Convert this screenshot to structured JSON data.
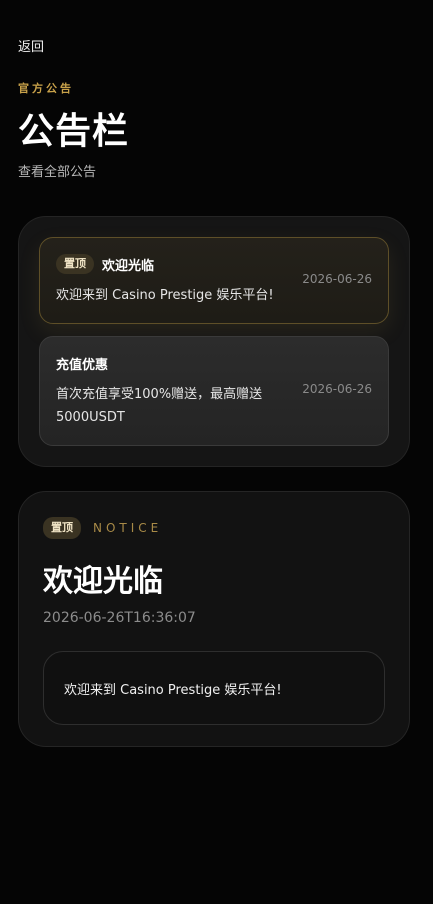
{
  "nav": {
    "back_label": "返回"
  },
  "header": {
    "eyebrow": "官方公告",
    "title": "公告栏",
    "subtitle": "查看全部公告"
  },
  "notices": [
    {
      "pinned": true,
      "pin_label": "置顶",
      "title": "欢迎光临",
      "body": "欢迎来到 Casino Prestige 娱乐平台!",
      "date": "2026-06-26"
    },
    {
      "pinned": false,
      "title": "充值优惠",
      "body": "首次充值享受100%赠送，最高赠送5000USDT",
      "date": "2026-06-26"
    }
  ],
  "detail": {
    "pin_label": "置顶",
    "eyebrow": "NOTICE",
    "title": "欢迎光临",
    "timestamp": "2026-06-26T16:36:07",
    "content": "欢迎来到 Casino Prestige 娱乐平台!"
  },
  "colors": {
    "accent_gold": "#c9a24a",
    "background": "#050505",
    "panel": "#151515"
  }
}
